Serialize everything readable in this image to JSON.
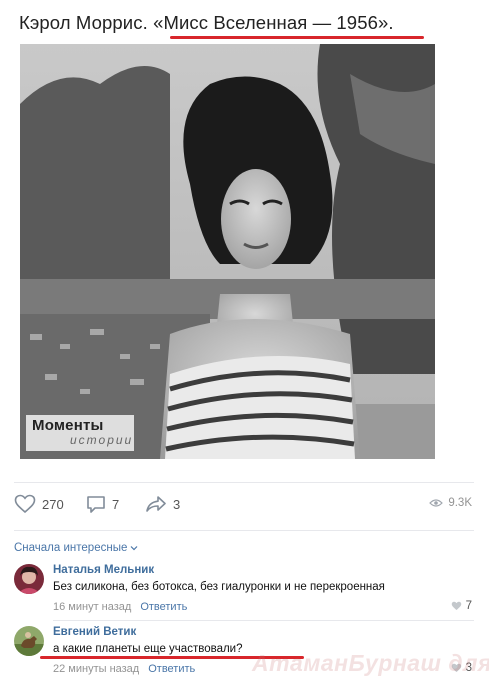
{
  "post": {
    "title": "Кэрол Моррис. «Мисс Вселенная — 1956».",
    "photo": {
      "watermark_line1": "Моменты",
      "watermark_line2": "истории"
    }
  },
  "actions": {
    "likes": {
      "icon": "heart-icon",
      "count": "270"
    },
    "comments": {
      "icon": "comment-icon",
      "count": "7"
    },
    "shares": {
      "icon": "share-icon",
      "count": "3"
    },
    "views": {
      "icon": "eye-icon",
      "count": "9.3K"
    }
  },
  "comments_section": {
    "sort_label": "Сначала интересные",
    "items": [
      {
        "author": "Наталья Мельник",
        "text": "Без силикона, без ботокса, без гиалуронки и не перекроенная",
        "time": "16 минут назад",
        "reply_label": "Ответить",
        "likes": "7"
      },
      {
        "author": "Евгений Ветик",
        "text": "а какие планеты еще участвовали?",
        "time": "22 минуты назад",
        "reply_label": "Ответить",
        "likes": "3"
      }
    ]
  },
  "site_watermark": "АтаманБурнаш для ЯП",
  "colors": {
    "accent_link": "#4a76a8",
    "author_link": "#3f6d9c",
    "highlight": "#d8262b",
    "muted": "#939393"
  }
}
